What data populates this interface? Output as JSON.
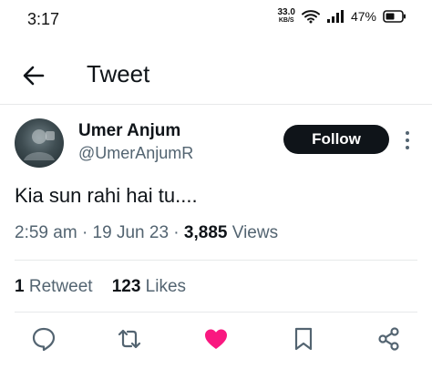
{
  "status_bar": {
    "time": "3:17",
    "net_speed_value": "33.0",
    "net_speed_unit": "KB/S",
    "battery_percent": "47%",
    "icons": [
      "wifi-icon",
      "signal-icon",
      "battery-icon"
    ]
  },
  "header": {
    "title": "Tweet",
    "back_icon": "back-arrow-icon"
  },
  "tweet": {
    "author_name": "Umer Anjum",
    "author_handle": "@UmerAnjumR",
    "follow_label": "Follow",
    "text": "Kia sun rahi hai tu....",
    "time": "2:59 am",
    "date": "19 Jun 23",
    "separator": "·",
    "views_count": "3,885",
    "views_label": "Views",
    "retweets_count": "1",
    "retweets_label": "Retweet",
    "likes_count": "123",
    "likes_label": "Likes",
    "liked": true
  },
  "actions": [
    "reply-icon",
    "retweet-icon",
    "like-icon",
    "bookmark-icon",
    "share-icon"
  ],
  "colors": {
    "primary_text": "#0f1419",
    "secondary_text": "#536471",
    "like": "#f91880",
    "follow_bg": "#0f1419",
    "divider": "#e7e9ea"
  }
}
